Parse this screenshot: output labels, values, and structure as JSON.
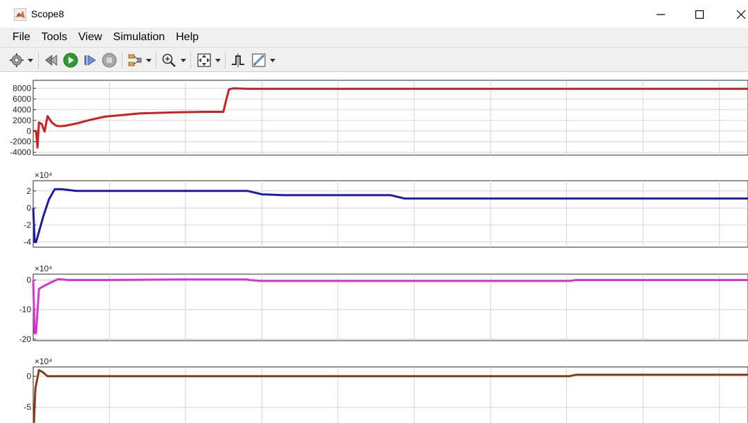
{
  "window": {
    "title": "Scope8",
    "minimize_glyph": "—",
    "close_glyph": "✕"
  },
  "menu": {
    "file": "File",
    "tools": "Tools",
    "view": "View",
    "simulation": "Simulation",
    "help": "Help"
  },
  "toolbar": {
    "icons": [
      "settings-gear-icon",
      "step-back-icon",
      "run-icon",
      "step-forward-icon",
      "stop-icon",
      "signal-layout-icon",
      "zoom-icon",
      "fit-to-view-icon",
      "triggers-icon",
      "measurement-icon"
    ]
  },
  "colors": {
    "plot1": "#cc1f1f",
    "plot2": "#1a1aa8",
    "plot3": "#d633d6",
    "plot4": "#8b3a12",
    "matlab_orange": "#e16b1f",
    "run_green": "#2e9c2e"
  },
  "chart_data": [
    {
      "type": "line",
      "ylim": [
        -4500,
        9500
      ],
      "yticks": [
        8000,
        6000,
        4000,
        2000,
        0,
        -2000,
        -4000
      ],
      "ytick_labels": [
        "8000",
        "6000",
        "4000",
        "2000",
        "0",
        "-2000",
        "-4000"
      ],
      "exponent_label": "",
      "x": [
        0,
        0.004,
        0.006,
        0.008,
        0.012,
        0.016,
        0.02,
        0.026,
        0.032,
        0.038,
        0.045,
        0.06,
        0.08,
        0.1,
        0.15,
        0.2,
        0.24,
        0.266,
        0.27,
        0.274,
        0.28,
        0.3,
        0.5,
        0.7,
        0.9,
        1.0
      ],
      "values": [
        0,
        0,
        -3100,
        1600,
        1300,
        -100,
        2800,
        1600,
        1000,
        900,
        1000,
        1400,
        2100,
        2700,
        3300,
        3500,
        3600,
        3600,
        5800,
        7800,
        8000,
        7900,
        7900,
        7900,
        7900,
        7900
      ],
      "color": "#cc1f1f"
    },
    {
      "type": "line",
      "ylim": [
        -46000,
        32000
      ],
      "yticks": [
        20000,
        0,
        -20000,
        -40000
      ],
      "ytick_labels": [
        "2",
        "0",
        "-2",
        "-4"
      ],
      "exponent_label": "×10⁴",
      "x": [
        0,
        0.002,
        0.004,
        0.008,
        0.014,
        0.022,
        0.03,
        0.04,
        0.06,
        0.1,
        0.2,
        0.3,
        0.32,
        0.35,
        0.4,
        0.5,
        0.52,
        0.54,
        0.6,
        0.8,
        1.0
      ],
      "values": [
        0,
        -40000,
        -40000,
        -28000,
        -10000,
        10000,
        22000,
        22000,
        20000,
        20000,
        20000,
        20000,
        16000,
        15000,
        15000,
        15000,
        11000,
        11000,
        11000,
        11000,
        11000
      ],
      "color": "#1a1aa8"
    },
    {
      "type": "line",
      "ylim": [
        -205000,
        20000
      ],
      "yticks": [
        0,
        -100000,
        -200000
      ],
      "ytick_labels": [
        "0",
        "-10",
        "-20"
      ],
      "exponent_label": "×10⁴",
      "x": [
        0,
        0.002,
        0.004,
        0.008,
        0.015,
        0.025,
        0.035,
        0.05,
        0.1,
        0.2,
        0.3,
        0.302,
        0.32,
        0.4,
        0.6,
        0.75,
        0.76,
        0.8,
        1.0
      ],
      "values": [
        0,
        -180000,
        -180000,
        -30000,
        -20000,
        -8000,
        3000,
        0,
        0,
        2000,
        2000,
        0,
        -3000,
        -3000,
        -3000,
        -3000,
        0,
        0,
        0
      ],
      "color": "#d633d6"
    },
    {
      "type": "line",
      "ylim": [
        -90000,
        15000
      ],
      "yticks": [
        0,
        -50000
      ],
      "ytick_labels": [
        "0",
        "-5"
      ],
      "exponent_label": "×10⁴",
      "x": [
        0,
        0.0005,
        0.003,
        0.008,
        0.014,
        0.02,
        0.03,
        0.1,
        0.5,
        0.75,
        0.76,
        0.8,
        1.0
      ],
      "values": [
        -90000,
        -90000,
        -20000,
        10000,
        6000,
        0,
        0,
        0,
        0,
        0,
        2500,
        2500,
        2500
      ],
      "color": "#8b3a12"
    }
  ]
}
